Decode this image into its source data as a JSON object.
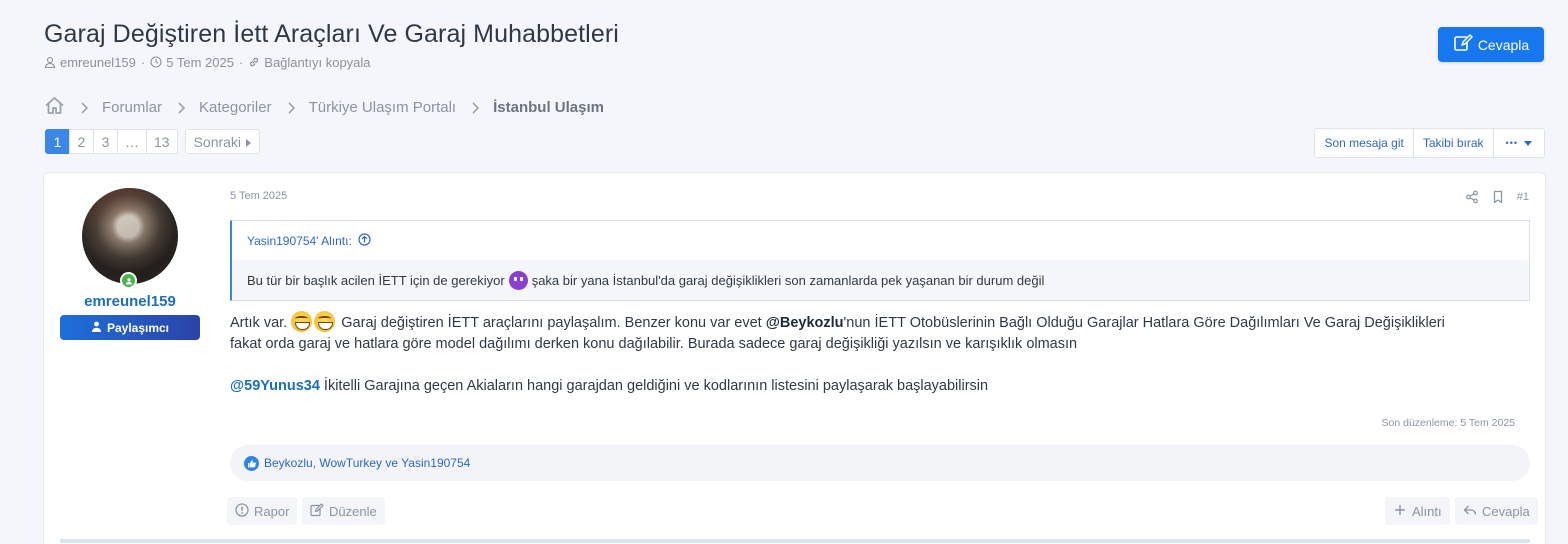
{
  "thread": {
    "title": "Garaj Değiştiren İett Araçları Ve Garaj Muhabbetleri",
    "author": "emreunel159",
    "date": "5 Tem 2025",
    "copy_link": "Bağlantıyı kopyala",
    "reply_button": "Cevapla"
  },
  "breadcrumb": {
    "items": [
      "Forumlar",
      "Kategoriler",
      "Türkiye Ulaşım Portalı"
    ],
    "current": "İstanbul Ulaşım"
  },
  "pagination": {
    "pages": [
      "1",
      "2",
      "3",
      "…",
      "13"
    ],
    "current": "1",
    "next": "Sonraki"
  },
  "thread_tools": {
    "last_post": "Son mesaja git",
    "unwatch": "Takibi bırak",
    "more": "•••"
  },
  "post": {
    "username": "emreunel159",
    "role": "Paylaşımcı",
    "date": "5 Tem 2025",
    "number": "#1",
    "quote_author": "Yasin190754' Alıntı:",
    "quote_text_1": "Bu tür bir başlık acilen İETT için de gerekiyor",
    "quote_text_2": "şaka bir yana İstanbul'da garaj değişiklikleri son zamanlarda pek yaşanan bir durum değil",
    "line1_start": "Artık var.",
    "line1_mid": " Garaj değiştiren İETT araçlarını paylaşalım. Benzer konu var evet ",
    "mention1": "@Beykozlu",
    "line1_end": "'nun İETT Otobüslerinin Bağlı Olduğu Garajlar Hatlara Göre Dağılımları Ve Garaj Değişiklikleri",
    "line2": "fakat orda garaj ve hatlara göre model dağılımı derken konu dağılabilir. Burada sadece garaj değişikliği yazılsın ve karışıklık olmasın",
    "mention2": "@59Yunus34",
    "line3": " İkitelli Garajına geçen Akiaların hangi garajdan geldiğini ve kodlarının listesini paylaşarak başlayabilirsin",
    "edited": "Son düzenleme: 5 Tem 2025",
    "reactions": "Beykozlu, WowTurkey ve Yasin190754",
    "report": "Rapor",
    "edit": "Düzenle",
    "quote_btn": "Alıntı",
    "reply_btn": "Cevapla"
  },
  "colors": {
    "accent": "#1677ee",
    "link": "#2d68c4",
    "online": "#4bb34f"
  }
}
